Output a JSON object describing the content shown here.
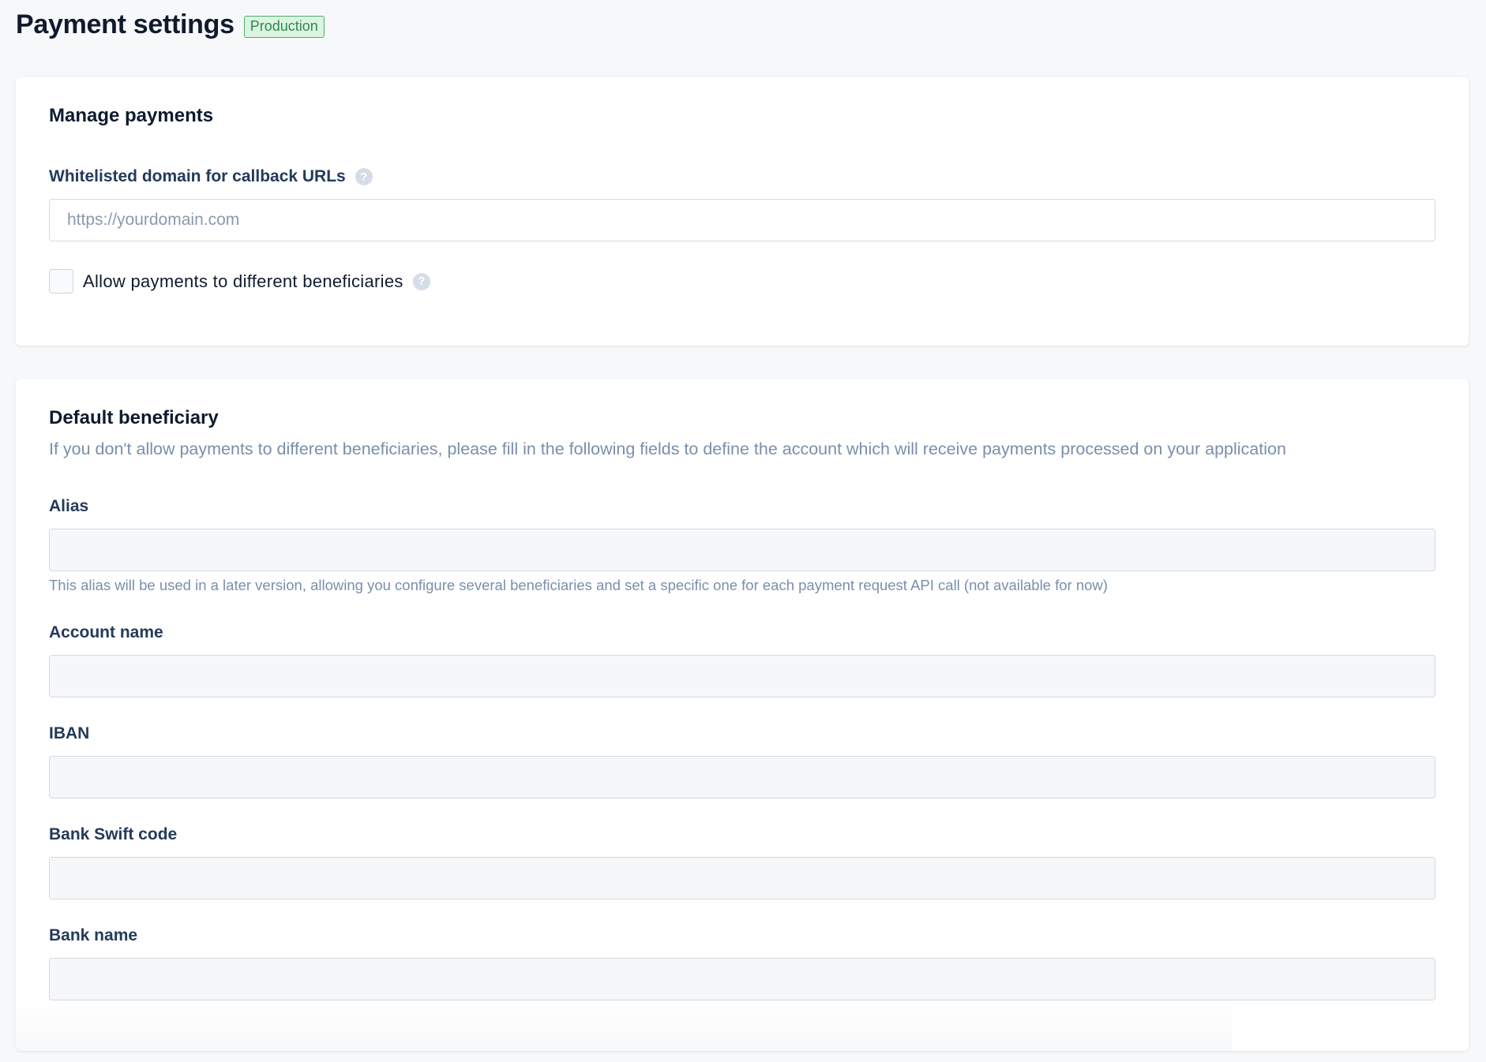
{
  "header": {
    "title": "Payment settings",
    "environment_badge": "Production"
  },
  "manage_payments": {
    "title": "Manage payments",
    "callback_domain": {
      "label": "Whitelisted domain for callback URLs",
      "placeholder": "https://yourdomain.com",
      "value": ""
    },
    "allow_different_beneficiaries": {
      "label": "Allow payments to different beneficiaries",
      "checked": false
    }
  },
  "default_beneficiary": {
    "title": "Default beneficiary",
    "description": "If you don't allow payments to different beneficiaries, please fill in the following fields to define the account which will receive payments processed on your application",
    "alias": {
      "label": "Alias",
      "value": "",
      "hint": "This alias will be used in a later version, allowing you configure several beneficiaries and set a specific one for each payment request API call (not available for now)"
    },
    "account_name": {
      "label": "Account name",
      "value": ""
    },
    "iban": {
      "label": "IBAN",
      "value": ""
    },
    "bank_swift_code": {
      "label": "Bank Swift code",
      "value": ""
    },
    "bank_name": {
      "label": "Bank name",
      "value": ""
    }
  },
  "icons": {
    "help": "question-mark-circle-icon",
    "help_glyph": "?"
  },
  "colors": {
    "badge_border": "#4caf6a",
    "badge_background": "#dcf3e2",
    "badge_text": "#2f8a48",
    "label_text": "#243a5a",
    "muted_text": "#7a8fab"
  }
}
